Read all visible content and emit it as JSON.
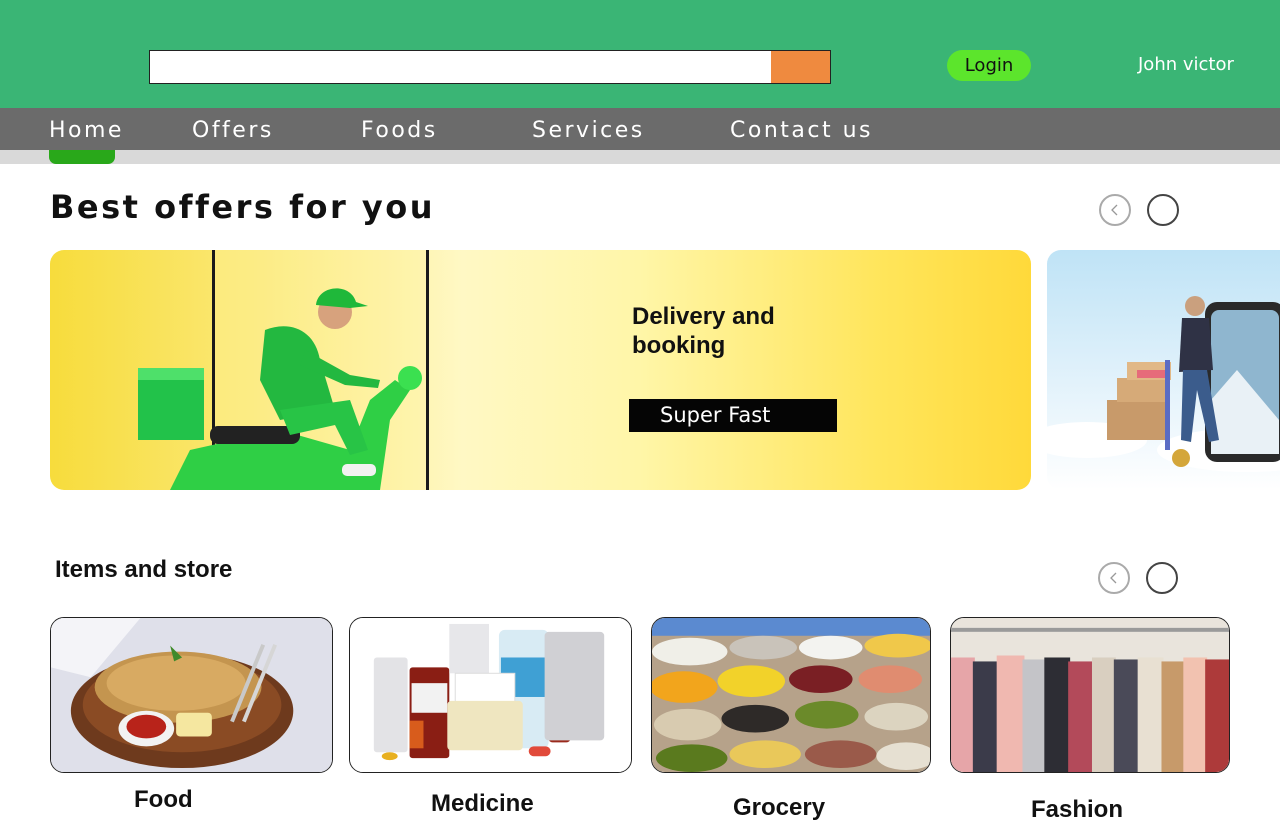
{
  "header": {
    "search": {
      "value": "",
      "placeholder": ""
    },
    "login_label": "Login",
    "user_name": "John victor"
  },
  "nav": {
    "items": [
      {
        "label": "Home",
        "active": true
      },
      {
        "label": "Offers"
      },
      {
        "label": "Foods"
      },
      {
        "label": "Services"
      },
      {
        "label": "Contact us"
      }
    ]
  },
  "offers": {
    "title": "Best offers for you",
    "banners": [
      {
        "heading": "Delivery and booking",
        "cta": "Super Fast"
      }
    ]
  },
  "items": {
    "title": "Items and store",
    "categories": [
      {
        "label": "Food"
      },
      {
        "label": "Medicine"
      },
      {
        "label": "Grocery"
      },
      {
        "label": "Fashion"
      }
    ]
  },
  "colors": {
    "header_bg": "#3ab575",
    "nav_bg": "#6b6b6b",
    "search_button": "#ef8a3f",
    "login_button": "#5ce52c",
    "active_indicator": "#29a81a",
    "cta_bg": "#050505"
  },
  "icons": [
    "search-button-icon",
    "chevron-left-icon",
    "circle-icon"
  ]
}
